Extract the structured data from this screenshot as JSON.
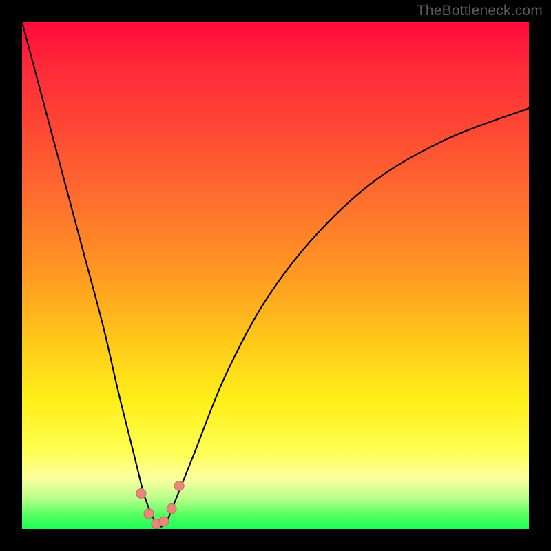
{
  "watermark": "TheBottleneck.com",
  "colors": {
    "frame_bg": "#000000",
    "watermark_text": "#5d5d5d",
    "gradient_top": "#ff0a3a",
    "gradient_mid1": "#ff6e2e",
    "gradient_mid2": "#ffc91a",
    "gradient_mid3": "#fff01a",
    "gradient_bottom": "#1aff55",
    "curve_stroke": "#000000",
    "marker_fill": "#e9877c",
    "marker_stroke": "#c46a60"
  },
  "chart_data": {
    "type": "line",
    "title": "",
    "xlabel": "",
    "ylabel": "",
    "xlim": [
      0,
      100
    ],
    "ylim": [
      0,
      100
    ],
    "grid": false,
    "series": [
      {
        "name": "bottleneck-curve",
        "x": [
          0,
          4,
          8,
          12,
          16,
          19,
          22,
          24,
          25.5,
          27,
          28.5,
          30,
          34,
          40,
          48,
          58,
          70,
          84,
          100
        ],
        "y": [
          100,
          85,
          70,
          55,
          40,
          27,
          15,
          7,
          3,
          0.5,
          1.5,
          5,
          15,
          30,
          45,
          58,
          69,
          77,
          83
        ]
      }
    ],
    "markers": {
      "name": "highlighted-points",
      "x": [
        23.5,
        25.0,
        26.5,
        28.0,
        29.5,
        31.0
      ],
      "y": [
        7.0,
        3.0,
        1.0,
        1.5,
        4.0,
        8.5
      ]
    }
  }
}
